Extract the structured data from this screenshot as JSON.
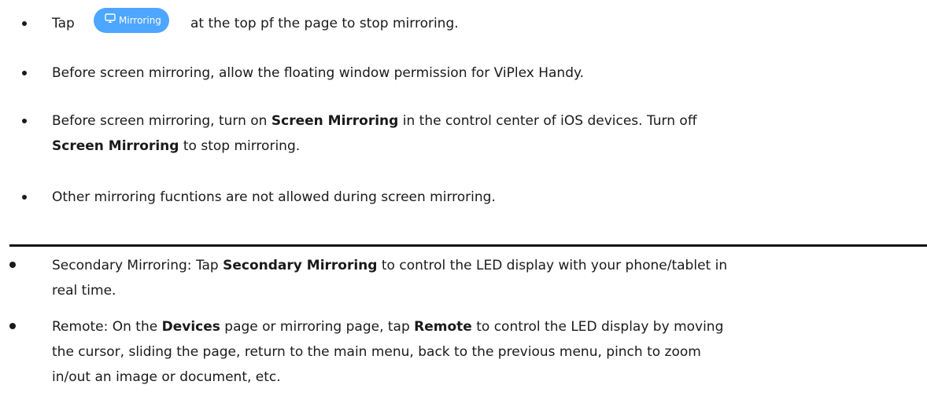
{
  "notes": {
    "item1": {
      "prefix": "Tap",
      "chip_label": "Mirroring",
      "chip_icon": "screen-mirror-icon",
      "suffix": "at the top pf the page to stop mirroring."
    },
    "item2": {
      "text": "Before screen mirroring, allow the floating window permission for ViPlex Handy."
    },
    "item3": {
      "part1": "Before screen mirroring, turn on ",
      "bold1": "Screen Mirroring",
      "part2": " in the control center of iOS devices. Turn off",
      "bold2": "Screen Mirroring",
      "part3": " to stop mirroring."
    },
    "item4": {
      "text": "Other mirroring fucntions are not allowed during screen mirroring."
    }
  },
  "body": {
    "item1": {
      "part1": "Secondary Mirroring: Tap ",
      "bold1": "Secondary Mirroring",
      "part2": " to control the LED display with your phone/tablet in",
      "line2": "real time."
    },
    "item2": {
      "part1": "Remote: On the ",
      "bold1": "Devices",
      "part2": " page or mirroring page, tap ",
      "bold2": "Remote",
      "part3": " to control the LED display by moving",
      "line2": "the cursor, sliding the page, return to the main menu, back to the previous menu, pinch to zoom",
      "line3": "in/out an image or document, etc."
    }
  },
  "colors": {
    "chip_background": "#4da6ff",
    "text": "#1a1a1a"
  }
}
